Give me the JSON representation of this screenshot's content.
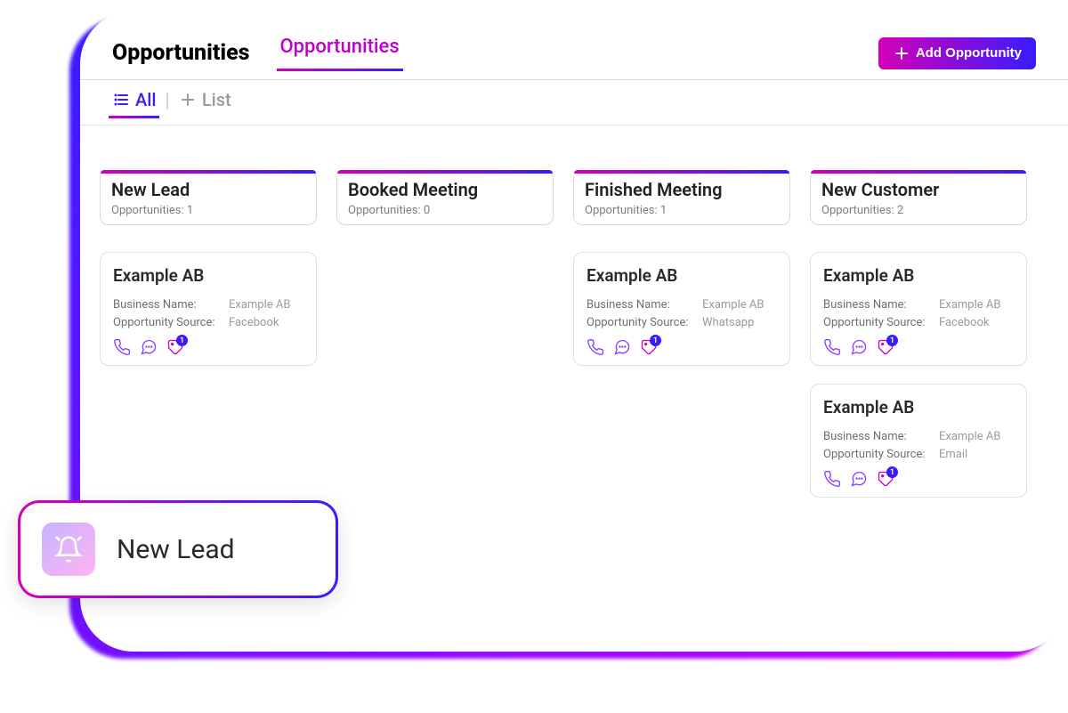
{
  "page": {
    "title": "Opportunities",
    "active_tab": "Opportunities"
  },
  "actions": {
    "add_label": "Add Opportunity"
  },
  "subtabs": {
    "all": "All",
    "list": "List"
  },
  "labels": {
    "opportunities_prefix": "Opportunities: ",
    "business_name": "Business Name:",
    "opportunity_source": "Opportunity Source:"
  },
  "columns": [
    {
      "title": "New Lead",
      "count": 1
    },
    {
      "title": "Booked Meeting",
      "count": 0
    },
    {
      "title": "Finished Meeting",
      "count": 1
    },
    {
      "title": "New Customer",
      "count": 2
    }
  ],
  "cards": {
    "c0": {
      "title": "Example AB",
      "business_name": "Example AB",
      "source": "Facebook",
      "tag_badge": 1
    },
    "c2": {
      "title": "Example AB",
      "business_name": "Example AB",
      "source": "Whatsapp",
      "tag_badge": 1
    },
    "c3a": {
      "title": "Example AB",
      "business_name": "Example AB",
      "source": "Facebook",
      "tag_badge": 1
    },
    "c3b": {
      "title": "Example AB",
      "business_name": "Example AB",
      "source": "Email",
      "tag_badge": 1
    }
  },
  "toast": {
    "label": "New Lead"
  }
}
